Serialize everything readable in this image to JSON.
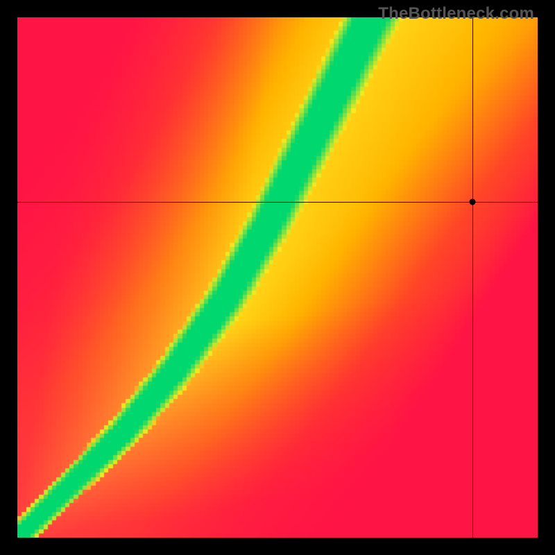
{
  "watermark": "TheBottleneck.com",
  "chart_data": {
    "type": "heatmap",
    "title": "",
    "xlabel": "",
    "ylabel": "",
    "xlim": [
      0,
      100
    ],
    "ylim": [
      0,
      100
    ],
    "color_scale": {
      "low": "#ff1744",
      "mid_low": "#ff9800",
      "mid": "#ffeb3b",
      "optimal": "#00e676",
      "description": "red→orange→yellow→green indicates distance from optimal pairing curve (green = optimal)"
    },
    "optimal_curve": {
      "description": "Parametric curve of balanced CPU/GPU combinations; green band follows this spine",
      "points": [
        {
          "x": 0,
          "y": 0
        },
        {
          "x": 10,
          "y": 10
        },
        {
          "x": 20,
          "y": 20
        },
        {
          "x": 30,
          "y": 32
        },
        {
          "x": 40,
          "y": 46
        },
        {
          "x": 48,
          "y": 60
        },
        {
          "x": 55,
          "y": 74
        },
        {
          "x": 62,
          "y": 88
        },
        {
          "x": 68,
          "y": 100
        }
      ]
    },
    "crosshair": {
      "x": 87.5,
      "y": 64.5,
      "description": "User-selected CPU/GPU combination marker"
    },
    "annotations": []
  }
}
